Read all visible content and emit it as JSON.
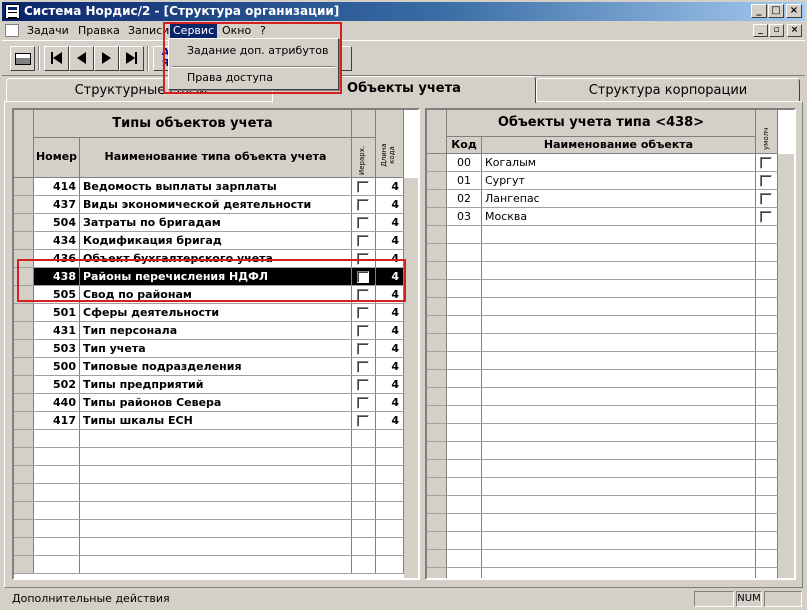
{
  "window": {
    "title": "Система Нордис/2 - [Структура организации]"
  },
  "menubar": {
    "items": [
      "Задачи",
      "Правка",
      "Записи",
      "Сервис",
      "Окно",
      "?"
    ]
  },
  "dropdown": {
    "items": [
      "Задание доп. атрибутов",
      "Права доступа"
    ]
  },
  "toolbar": {
    "print_icon": "printer-icon",
    "first_icon": "first-record-icon",
    "prev_icon": "prev-record-icon",
    "next_icon": "next-record-icon",
    "last_icon": "last-record-icon",
    "sort_label": "А\nЯ"
  },
  "tabs": [
    {
      "label": "Структурные связи",
      "active": false
    },
    {
      "label": "Объекты учета",
      "active": true
    },
    {
      "label": "Структура корпорации",
      "active": false
    }
  ],
  "left_table": {
    "title": "Типы объектов учета",
    "col_number": "Номер",
    "col_name": "Наименование типа объекта учета",
    "col_hier": "Иерарх.",
    "col_len": "Длина кода",
    "rows": [
      {
        "number": "414",
        "name": "Ведомость выплаты зарплаты",
        "hier": false,
        "len": "4"
      },
      {
        "number": "437",
        "name": "Виды экономической деятельности",
        "hier": false,
        "len": "4"
      },
      {
        "number": "504",
        "name": "Затраты по бригадам",
        "hier": false,
        "len": "4"
      },
      {
        "number": "434",
        "name": "Кодификация бригад",
        "hier": false,
        "len": "4"
      },
      {
        "number": "436",
        "name": "Объект бухгалтерского учета",
        "hier": false,
        "len": "4"
      },
      {
        "number": "438",
        "name": "Районы перечисления НДФЛ",
        "hier": false,
        "len": "4",
        "selected": true
      },
      {
        "number": "505",
        "name": "Свод по районам",
        "hier": false,
        "len": "4"
      },
      {
        "number": "501",
        "name": "Сферы деятельности",
        "hier": false,
        "len": "4"
      },
      {
        "number": "431",
        "name": "Тип персонала",
        "hier": false,
        "len": "4"
      },
      {
        "number": "503",
        "name": "Тип учета",
        "hier": false,
        "len": "4"
      },
      {
        "number": "500",
        "name": "Типовые подразделения",
        "hier": false,
        "len": "4"
      },
      {
        "number": "502",
        "name": "Типы предприятий",
        "hier": false,
        "len": "4"
      },
      {
        "number": "440",
        "name": "Типы районов Севера",
        "hier": false,
        "len": "4"
      },
      {
        "number": "417",
        "name": "Типы шкалы ЕСН",
        "hier": false,
        "len": "4"
      }
    ]
  },
  "right_table": {
    "title": "Объекты учета типа <438>",
    "col_code": "Код",
    "col_name": "Наименование объекта",
    "col_default": "умолч",
    "rows": [
      {
        "code": "00",
        "name": "Когалым",
        "default": false
      },
      {
        "code": "01",
        "name": "Сургут",
        "default": false
      },
      {
        "code": "02",
        "name": "Лангепас",
        "default": false
      },
      {
        "code": "03",
        "name": "Москва",
        "default": false
      }
    ]
  },
  "statusbar": {
    "text": "Дополнительные действия",
    "num": "NUM"
  },
  "colors": {
    "titlebar_start": "#0a246a",
    "highlight_box": "#d42020",
    "selection": "#000000"
  }
}
